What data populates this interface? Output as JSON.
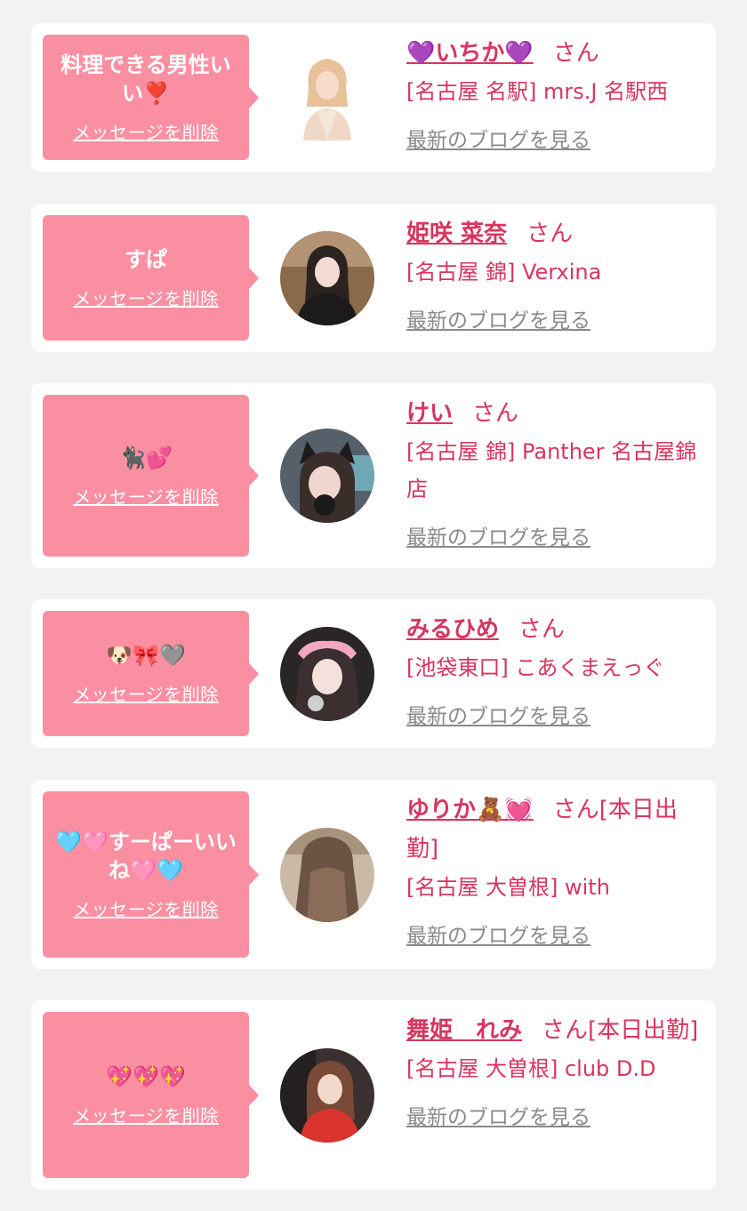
{
  "delete_label": "メッセージを削除",
  "blog_label": "最新のブログを見る",
  "san_label": "さん",
  "cards": [
    {
      "message": "料理できる男性いい❣️",
      "name": "💜いちか💜",
      "suffix": "",
      "shop": "[名古屋 名駅] mrs.J 名駅西"
    },
    {
      "message": "すぱ",
      "name": "姫咲 菜奈",
      "suffix": "",
      "shop": "[名古屋 錦] Verxina"
    },
    {
      "message": "🐈‍⬛💕",
      "name": "けい",
      "suffix": "",
      "shop": "[名古屋 錦] Panther 名古屋錦店"
    },
    {
      "message": "🐶🎀🩶",
      "name": "みるひめ",
      "suffix": "",
      "shop": "[池袋東口] こあくまえっぐ"
    },
    {
      "message": "🩵🩷すーぱーいいね🩷🩵",
      "name": "ゆりか🧸💓",
      "suffix": "[本日出勤]",
      "shop": "[名古屋 大曽根] with"
    },
    {
      "message": "💖💖💖",
      "name": "舞姫　れみ",
      "suffix": "[本日出勤]",
      "shop": "[名古屋 大曽根] club D.D"
    }
  ],
  "colors": {
    "accent": "#d8355f",
    "bubble": "#fb8fa2",
    "background": "#f2f2f2",
    "muted": "#8a8a8a"
  }
}
